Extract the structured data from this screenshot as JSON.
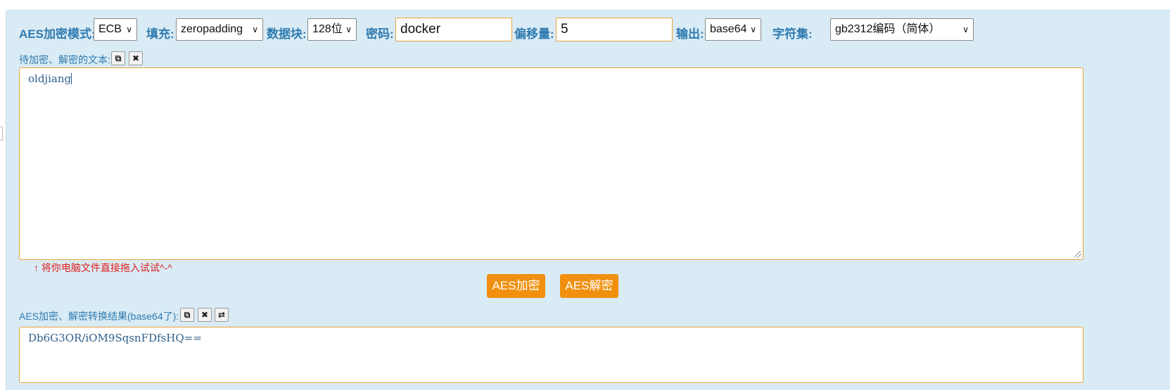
{
  "toolbar": {
    "mode_label": "AES加密模式:",
    "mode_value": "ECB",
    "padding_label": "填充:",
    "padding_value": "zeropadding",
    "block_label": "数据块:",
    "block_value": "128位",
    "key_label": "密码:",
    "key_value": "docker",
    "offset_label": "偏移量:",
    "offset_value": "5",
    "output_label": "输出:",
    "output_value": "base64",
    "charset_label": "字符集:",
    "charset_value": "gb2312编码（简体）"
  },
  "input_section": {
    "label": "待加密、解密的文本:",
    "text": "oldjiang",
    "hint": "↑ 将你电脑文件直接拖入试试^-^"
  },
  "actions": {
    "encrypt_label": "AES加密",
    "decrypt_label": "AES解密"
  },
  "result_section": {
    "label": "AES加密、解密转换结果(base64了):",
    "text": "Db6G3OR/iOM9SqsnFDfsHQ=="
  },
  "icons": [
    "copy-icon",
    "clear-icon",
    "swap-icon",
    "chevron-down-icon"
  ],
  "colors": {
    "accent": "#f0900e",
    "label": "#2f7bb0",
    "panel": "#d9ebf5",
    "hint": "#e02020"
  }
}
